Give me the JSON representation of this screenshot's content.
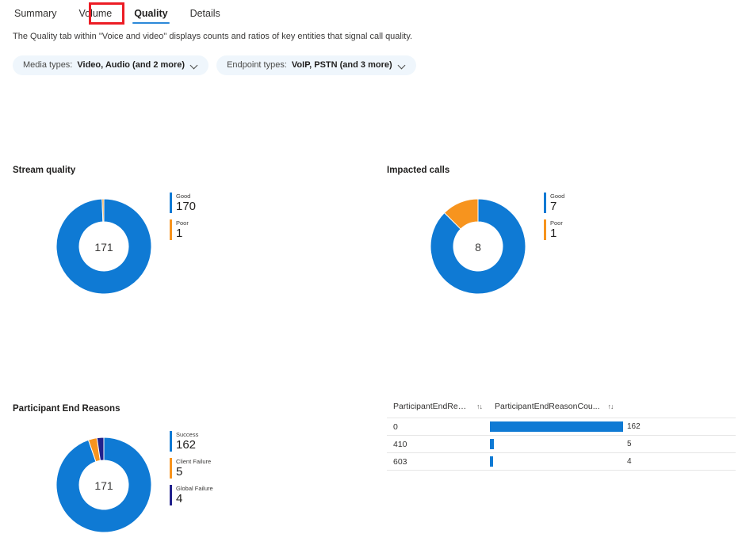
{
  "tabs": [
    {
      "label": "Summary",
      "active": false
    },
    {
      "label": "Volume",
      "active": false
    },
    {
      "label": "Quality",
      "active": true
    },
    {
      "label": "Details",
      "active": false
    }
  ],
  "description": "The Quality tab within \"Voice and video\" displays counts and ratios of key entities that signal call quality.",
  "filters": [
    {
      "prefix": "Media types:",
      "value": "Video, Audio (and 2 more)"
    },
    {
      "prefix": "Endpoint types:",
      "value": "VoIP, PSTN (and 3 more)"
    }
  ],
  "colors": {
    "blue": "#0f7ad4",
    "orange": "#f7941e",
    "navy": "#21218c",
    "accent_underline": "#2b88d8",
    "highlight_box": "#ec1c24"
  },
  "panels": {
    "stream_quality": {
      "title": "Stream quality"
    },
    "impacted_calls": {
      "title": "Impacted calls"
    },
    "end_reasons": {
      "title": "Participant End Reasons"
    }
  },
  "chart_data": [
    {
      "type": "pie",
      "name": "stream-quality",
      "title": "Stream quality",
      "center_total": "171",
      "total": 171,
      "categories": [
        "Good",
        "Poor"
      ],
      "values": [
        170,
        1
      ],
      "colors": [
        "#0f7ad4",
        "#f7941e"
      ],
      "legend": [
        {
          "label": "Good",
          "value": "170",
          "color": "#0f7ad4"
        },
        {
          "label": "Poor",
          "value": "1",
          "color": "#f7941e"
        }
      ],
      "legend_position": "right"
    },
    {
      "type": "pie",
      "name": "impacted-calls",
      "title": "Impacted calls",
      "center_total": "8",
      "total": 8,
      "categories": [
        "Good",
        "Poor"
      ],
      "values": [
        7,
        1
      ],
      "colors": [
        "#0f7ad4",
        "#f7941e"
      ],
      "legend": [
        {
          "label": "Good",
          "value": "7",
          "color": "#0f7ad4"
        },
        {
          "label": "Poor",
          "value": "1",
          "color": "#f7941e"
        }
      ],
      "legend_position": "right"
    },
    {
      "type": "pie",
      "name": "participant-end-reasons",
      "title": "Participant End Reasons",
      "center_total": "171",
      "total": 171,
      "categories": [
        "Success",
        "Client Failure",
        "Global Failure"
      ],
      "values": [
        162,
        5,
        4
      ],
      "colors": [
        "#0f7ad4",
        "#f7941e",
        "#21218c"
      ],
      "legend": [
        {
          "label": "Success",
          "value": "162",
          "color": "#0f7ad4"
        },
        {
          "label": "Client Failure",
          "value": "5",
          "color": "#f7941e"
        },
        {
          "label": "Global Failure",
          "value": "4",
          "color": "#21218c"
        }
      ],
      "legend_position": "right"
    },
    {
      "type": "table",
      "name": "participant-end-reason-table",
      "columns": [
        "ParticipantEndReason",
        "ParticipantEndReasonCou..."
      ],
      "rows": [
        {
          "reason": "0",
          "count": 162
        },
        {
          "reason": "410",
          "count": 5
        },
        {
          "reason": "603",
          "count": 4
        }
      ],
      "max_count": 162,
      "sort_icon": "↑↓"
    }
  ]
}
